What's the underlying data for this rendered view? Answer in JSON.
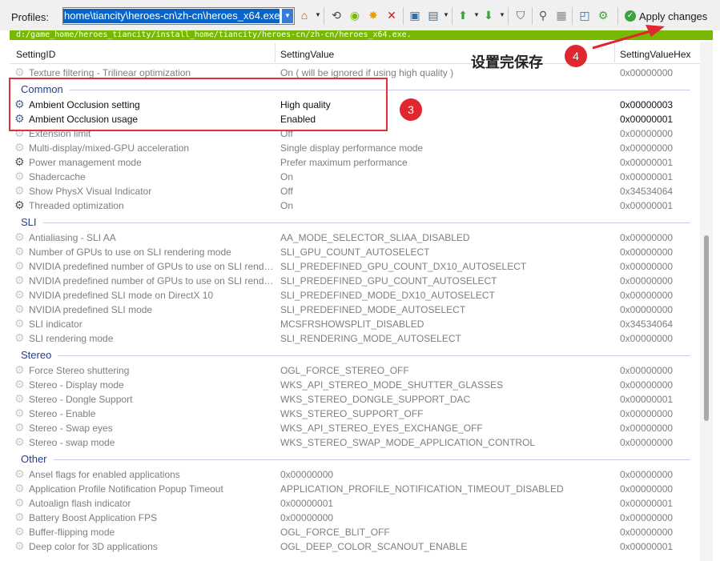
{
  "toolbar": {
    "profiles_label": "Profiles:",
    "profile_value": "home\\tiancity\\heroes-cn\\zh-cn\\heroes_x64.exe",
    "apply_label": "Apply changes"
  },
  "path_bar": "d:/game_home/heroes_tiancity/install_home/tiancity/heroes-cn/zh-cn/heroes_x64.exe.",
  "columns": [
    "SettingID",
    "SettingValue",
    "SettingValueHex"
  ],
  "rows": [
    {
      "type": "row",
      "id": "Texture filtering - Trilinear optimization",
      "value": "On ( will be ignored if using high quality )",
      "hex": "0x00000000",
      "style": "dim"
    },
    {
      "type": "group",
      "title": "Common"
    },
    {
      "type": "row",
      "id": "Ambient Occlusion setting",
      "value": "High quality",
      "hex": "0x00000003",
      "style": "bold"
    },
    {
      "type": "row",
      "id": "Ambient Occlusion usage",
      "value": "Enabled",
      "hex": "0x00000001",
      "style": "bold"
    },
    {
      "type": "row",
      "id": "Extension limit",
      "value": "Off",
      "hex": "0x00000000",
      "style": "dim"
    },
    {
      "type": "row",
      "id": "Multi-display/mixed-GPU acceleration",
      "value": "Single display performance mode",
      "hex": "0x00000000",
      "style": "dim"
    },
    {
      "type": "row",
      "id": "Power management mode",
      "value": "Prefer maximum performance",
      "hex": "0x00000001",
      "style": "bold-dim"
    },
    {
      "type": "row",
      "id": "Shadercache",
      "value": "On",
      "hex": "0x00000001",
      "style": "dim"
    },
    {
      "type": "row",
      "id": "Show PhysX Visual Indicator",
      "value": "Off",
      "hex": "0x34534064",
      "style": "dim"
    },
    {
      "type": "row",
      "id": "Threaded optimization",
      "value": "On",
      "hex": "0x00000001",
      "style": "bold-dim"
    },
    {
      "type": "group",
      "title": "SLI"
    },
    {
      "type": "row",
      "id": "Antialiasing - SLI AA",
      "value": "AA_MODE_SELECTOR_SLIAA_DISABLED",
      "hex": "0x00000000",
      "style": "dim"
    },
    {
      "type": "row",
      "id": "Number of GPUs to use on SLI rendering mode",
      "value": "SLI_GPU_COUNT_AUTOSELECT",
      "hex": "0x00000000",
      "style": "dim"
    },
    {
      "type": "row",
      "id": "NVIDIA predefined number of GPUs to use on SLI rendering m...",
      "value": "SLI_PREDEFINED_GPU_COUNT_DX10_AUTOSELECT",
      "hex": "0x00000000",
      "style": "dim"
    },
    {
      "type": "row",
      "id": "NVIDIA predefined number of GPUs to use on SLI rendering m...",
      "value": "SLI_PREDEFINED_GPU_COUNT_AUTOSELECT",
      "hex": "0x00000000",
      "style": "dim"
    },
    {
      "type": "row",
      "id": "NVIDIA predefined SLI mode on DirectX 10",
      "value": "SLI_PREDEFINED_MODE_DX10_AUTOSELECT",
      "hex": "0x00000000",
      "style": "dim"
    },
    {
      "type": "row",
      "id": "NVIDIA predefined SLI mode",
      "value": "SLI_PREDEFINED_MODE_AUTOSELECT",
      "hex": "0x00000000",
      "style": "dim"
    },
    {
      "type": "row",
      "id": "SLI indicator",
      "value": "MCSFRSHOWSPLIT_DISABLED",
      "hex": "0x34534064",
      "style": "dim"
    },
    {
      "type": "row",
      "id": "SLI rendering mode",
      "value": "SLI_RENDERING_MODE_AUTOSELECT",
      "hex": "0x00000000",
      "style": "dim"
    },
    {
      "type": "group",
      "title": "Stereo"
    },
    {
      "type": "row",
      "id": "Force Stereo shuttering",
      "value": "OGL_FORCE_STEREO_OFF",
      "hex": "0x00000000",
      "style": "dim"
    },
    {
      "type": "row",
      "id": "Stereo - Display mode",
      "value": "WKS_API_STEREO_MODE_SHUTTER_GLASSES",
      "hex": "0x00000000",
      "style": "dim"
    },
    {
      "type": "row",
      "id": "Stereo - Dongle Support",
      "value": "WKS_STEREO_DONGLE_SUPPORT_DAC",
      "hex": "0x00000001",
      "style": "dim"
    },
    {
      "type": "row",
      "id": "Stereo - Enable",
      "value": "WKS_STEREO_SUPPORT_OFF",
      "hex": "0x00000000",
      "style": "dim"
    },
    {
      "type": "row",
      "id": "Stereo - Swap eyes",
      "value": "WKS_API_STEREO_EYES_EXCHANGE_OFF",
      "hex": "0x00000000",
      "style": "dim"
    },
    {
      "type": "row",
      "id": "Stereo - swap mode",
      "value": "WKS_STEREO_SWAP_MODE_APPLICATION_CONTROL",
      "hex": "0x00000000",
      "style": "dim"
    },
    {
      "type": "group",
      "title": "Other"
    },
    {
      "type": "row",
      "id": "Ansel flags for enabled applications",
      "value": "0x00000000",
      "hex": "0x00000000",
      "style": "dim"
    },
    {
      "type": "row",
      "id": "Application Profile Notification Popup Timeout",
      "value": "APPLICATION_PROFILE_NOTIFICATION_TIMEOUT_DISABLED",
      "hex": "0x00000000",
      "style": "dim"
    },
    {
      "type": "row",
      "id": "Autoalign flash indicator",
      "value": "0x00000001",
      "hex": "0x00000001",
      "style": "dim"
    },
    {
      "type": "row",
      "id": "Battery Boost Application FPS",
      "value": "0x00000000",
      "hex": "0x00000000",
      "style": "dim"
    },
    {
      "type": "row",
      "id": "Buffer-flipping mode",
      "value": "OGL_FORCE_BLIT_OFF",
      "hex": "0x00000000",
      "style": "dim"
    },
    {
      "type": "row",
      "id": "Deep color for 3D applications",
      "value": "OGL_DEEP_COLOR_SCANOUT_ENABLE",
      "hex": "0x00000001",
      "style": "dim"
    }
  ],
  "annotations": {
    "badge_3": "3",
    "badge_4": "4",
    "note_text": "设置完保存"
  },
  "colors": {
    "path_bar": "#77b900",
    "highlight": "#e0313a",
    "group_title": "#1e3f9a"
  }
}
